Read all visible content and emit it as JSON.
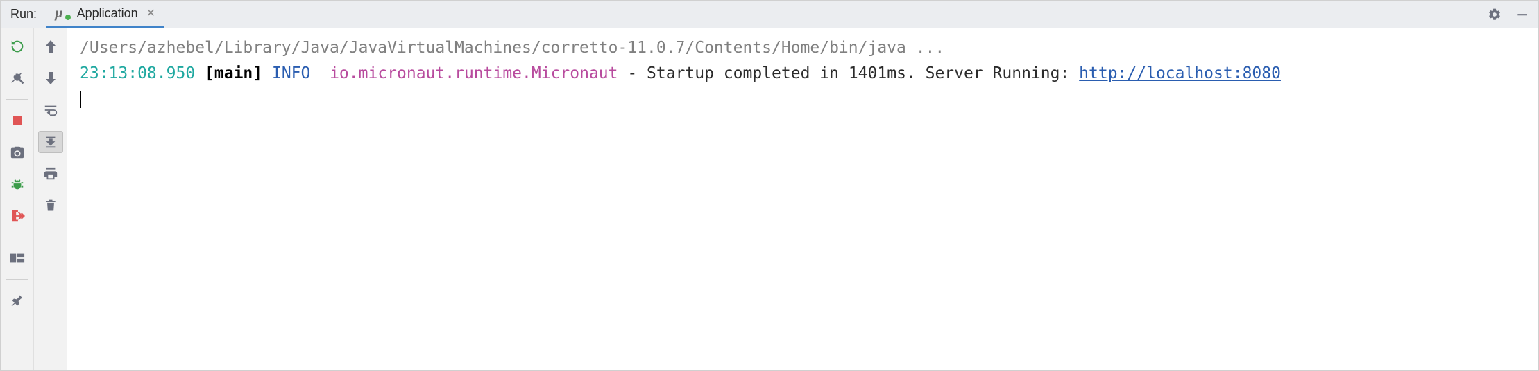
{
  "header": {
    "label": "Run:",
    "tab": {
      "title": "Application"
    }
  },
  "console": {
    "command": "/Users/azhebel/Library/Java/JavaVirtualMachines/corretto-11.0.7/Contents/Home/bin/java ...",
    "log": {
      "timestamp": "23:13:08.950",
      "thread": "[main]",
      "level": "INFO",
      "logger": "io.micronaut.runtime.Micronaut",
      "sep": " - ",
      "message": "Startup completed in 1401ms. Server Running: ",
      "url": "http://localhost:8080"
    }
  }
}
